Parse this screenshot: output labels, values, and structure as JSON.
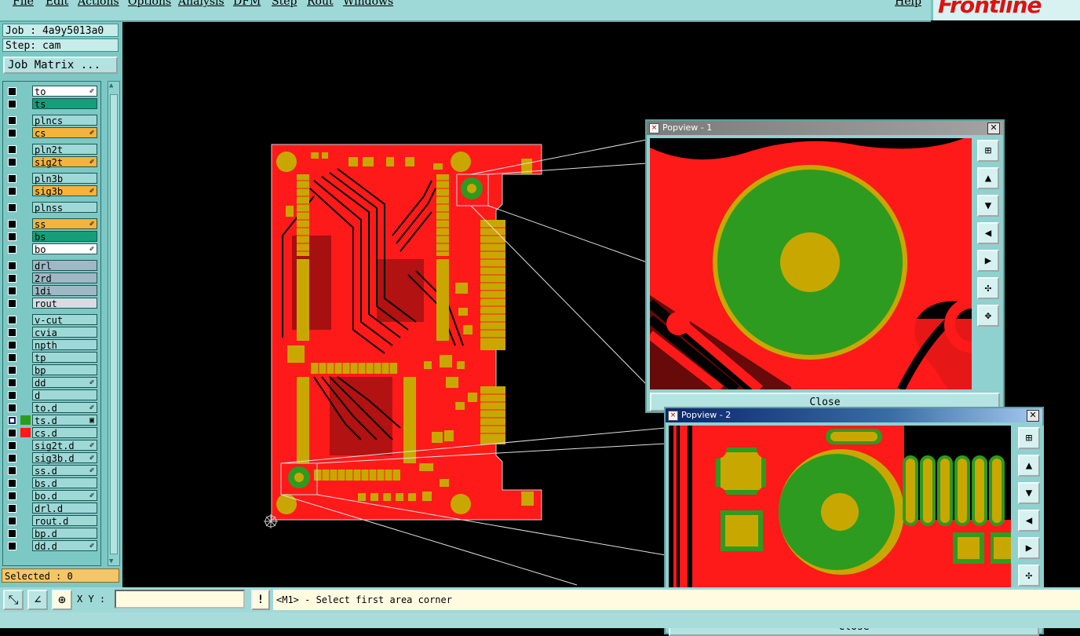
{
  "menu": {
    "items": [
      "File",
      "Edit",
      "Actions",
      "Options",
      "Analysis",
      "DFM",
      "Step",
      "Rout",
      "Windows"
    ],
    "help": "Help"
  },
  "logo": {
    "text": "Frontline"
  },
  "job": {
    "job_label": "Job : 4a9y5013a0",
    "step_label": "Step: cam",
    "matrix_button": "Job Matrix ..."
  },
  "layers": [
    {
      "name": "to",
      "color": "#ffffff",
      "edit": true
    },
    {
      "name": "ts",
      "color": "#159e78",
      "edit": false
    },
    {
      "name": "plncs",
      "color": "#9ed9d7",
      "edit": false
    },
    {
      "name": "cs",
      "color": "#f4b33d",
      "edit": true
    },
    {
      "name": "pln2t",
      "color": "#9ed9d7",
      "edit": false
    },
    {
      "name": "sig2t",
      "color": "#f4b33d",
      "edit": true
    },
    {
      "name": "pln3b",
      "color": "#9ed9d7",
      "edit": false
    },
    {
      "name": "sig3b",
      "color": "#f4b33d",
      "edit": true
    },
    {
      "name": "plnss",
      "color": "#9ed9d7",
      "edit": false
    },
    {
      "name": "ss",
      "color": "#f4b33d",
      "edit": true
    },
    {
      "name": "bs",
      "color": "#159e78",
      "edit": false
    },
    {
      "name": "bo",
      "color": "#ffffff",
      "edit": true
    },
    {
      "name": "drl",
      "color": "#9fb8c6",
      "edit": false
    },
    {
      "name": "2rd",
      "color": "#9fb8c6",
      "edit": false
    },
    {
      "name": "1di",
      "color": "#9fb8c6",
      "edit": false
    },
    {
      "name": "rout",
      "color": "#d5dde2",
      "edit": false
    },
    {
      "name": "v-cut",
      "color": "#9ed9d7",
      "edit": false
    },
    {
      "name": "cvia",
      "color": "#9ed9d7",
      "edit": false
    },
    {
      "name": "npth",
      "color": "#9ed9d7",
      "edit": false
    },
    {
      "name": "tp",
      "color": "#9ed9d7",
      "edit": false
    },
    {
      "name": "bp",
      "color": "#9ed9d7",
      "edit": false
    },
    {
      "name": "dd",
      "color": "#9ed9d7",
      "edit": true
    },
    {
      "name": "d",
      "color": "#9ed9d7",
      "edit": false
    },
    {
      "name": "to.d",
      "color": "#9ed9d7",
      "edit": true
    },
    {
      "name": "ts.d",
      "color": "#9ed9d7",
      "edit": false,
      "active": true,
      "swatch": "#2d9b20"
    },
    {
      "name": "cs.d",
      "color": "#9ed9d7",
      "edit": false,
      "swatch": "#ff1a1a"
    },
    {
      "name": "sig2t.d",
      "color": "#9ed9d7",
      "edit": true
    },
    {
      "name": "sig3b.d",
      "color": "#9ed9d7",
      "edit": true
    },
    {
      "name": "ss.d",
      "color": "#9ed9d7",
      "edit": true
    },
    {
      "name": "bs.d",
      "color": "#9ed9d7",
      "edit": false
    },
    {
      "name": "bo.d",
      "color": "#9ed9d7",
      "edit": true
    },
    {
      "name": "drl.d",
      "color": "#9ed9d7",
      "edit": false
    },
    {
      "name": "rout.d",
      "color": "#9ed9d7",
      "edit": false
    },
    {
      "name": "bp.d",
      "color": "#9ed9d7",
      "edit": false
    },
    {
      "name": "dd.d",
      "color": "#9ed9d7",
      "edit": true
    }
  ],
  "selected": "Selected : 0",
  "bottom": {
    "xy_label": "X Y :",
    "xy_value": "",
    "prompt": "<M1> - Select first area corner"
  },
  "popview1": {
    "title": "Popview - 1",
    "close": "Close"
  },
  "popview2": {
    "title": "Popview - 2",
    "close": "Close"
  },
  "colors": {
    "copper": "#ff1a1a",
    "pad": "#c8a800",
    "mask": "#2d9b20",
    "panel": "#9ed9d7"
  }
}
